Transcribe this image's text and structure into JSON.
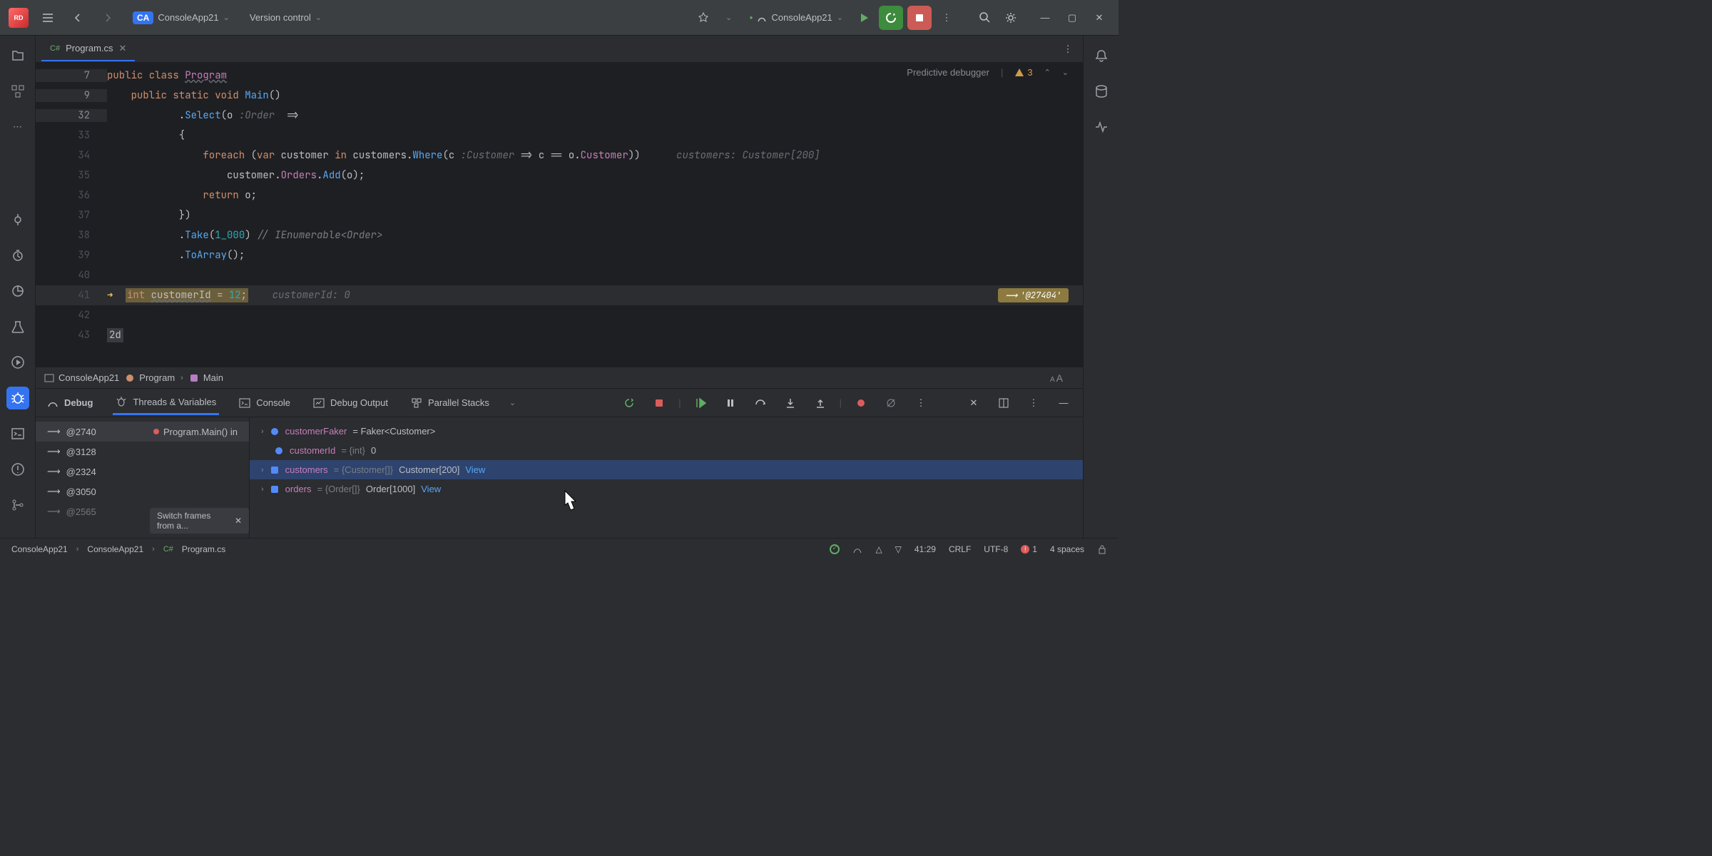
{
  "titlebar": {
    "app_logo": "RD",
    "project_badge": "CA",
    "project_name": "ConsoleApp21",
    "version_control": "Version control",
    "run_config": "ConsoleApp21"
  },
  "tab": {
    "icon_label": "C#",
    "filename": "Program.cs"
  },
  "editor_header": {
    "predictive": "Predictive debugger",
    "warning_count": "3"
  },
  "code": {
    "line7_num": "7",
    "line7": "public class Program",
    "line9_num": "9",
    "line9": "    public static void Main()",
    "line32_num": "32",
    "line32_a": "            .Select(o",
    "line32_hint": ":Order",
    "line32_b": "  =>",
    "line33_num": "33",
    "line33": "            {",
    "line34_num": "34",
    "line34_a": "                foreach (var customer in customers.Where(c",
    "line34_hint": ":Customer",
    "line34_b": " => c == o.Customer))",
    "line34_inline": "   customers: Customer[200]",
    "line35_num": "35",
    "line35": "                    customer.Orders.Add(o);",
    "line36_num": "36",
    "line36": "                return o;",
    "line37_num": "37",
    "line37": "            })",
    "line38_num": "38",
    "line38_a": "            .Take(1_000)",
    "line38_comment": " // IEnumerable<Order>",
    "line39_num": "39",
    "line39": "            .ToArray();",
    "line40_num": "40",
    "line41_num": "41",
    "line41_code": "int customerId = 12;",
    "line41_inline": "    customerId: 0",
    "line41_marker": "'@27404'",
    "line42_num": "42",
    "line43_num": "43",
    "line43": "2d"
  },
  "breadcrumb": {
    "item1": "ConsoleApp21",
    "item2": "Program",
    "item3": "Main"
  },
  "debug": {
    "tab_debug": "Debug",
    "tab_threads": "Threads & Variables",
    "tab_console": "Console",
    "tab_output": "Debug Output",
    "tab_stacks": "Parallel Stacks",
    "threads": [
      "@2740",
      "@3128",
      "@2324",
      "@3050",
      "@2565"
    ],
    "frame": "Program.Main() in ",
    "frame_popup": "Switch frames from a...",
    "vars": {
      "v1_name": "customerFaker",
      "v1_val": " = Faker<Customer>",
      "v2_name": "customerId",
      "v2_type": " = {int} ",
      "v2_val": "0",
      "v3_name": "customers",
      "v3_type": " = {Customer[]} ",
      "v3_val": "Customer[200]",
      "v3_link": "View",
      "v4_name": "orders",
      "v4_type": " = {Order[]} ",
      "v4_val": "Order[1000]",
      "v4_link": "View"
    }
  },
  "statusbar": {
    "path1": "ConsoleApp21",
    "path2": "ConsoleApp21",
    "path3_icon": "C#",
    "path3": "Program.cs",
    "cursor": "41:29",
    "line_sep": "CRLF",
    "encoding": "UTF-8",
    "errors": "1",
    "indent": "4 spaces"
  }
}
